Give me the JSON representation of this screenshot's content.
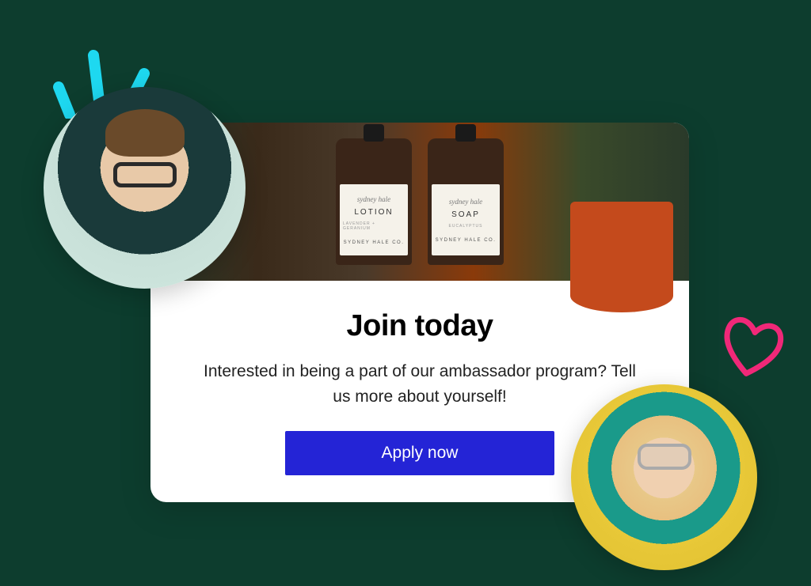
{
  "card": {
    "title": "Join today",
    "description": "Interested in being a part of our ambassador program? Tell us more about yourself!",
    "apply_label": "Apply now"
  },
  "hero": {
    "bottle1_product": "LOTION",
    "bottle1_sub": "LAVENDER + GERANIUM",
    "bottle2_product": "SOAP",
    "bottle2_sub": "EUCALYPTUS",
    "brand": "SYDNEY HALE CO."
  },
  "decor": {
    "spark_color": "#1ed8f0",
    "heart_color": "#f02878"
  }
}
